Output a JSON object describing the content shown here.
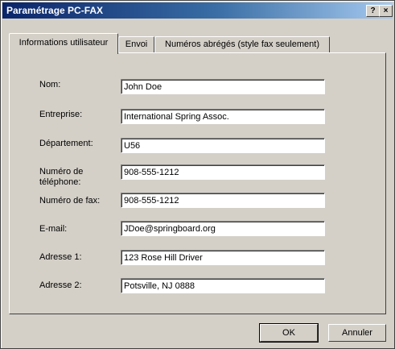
{
  "window": {
    "title": "Paramétrage PC-FAX",
    "help_glyph": "?",
    "close_glyph": "×"
  },
  "tabs": [
    {
      "label": "Informations utilisateur",
      "active": true
    },
    {
      "label": "Envoi",
      "active": false
    },
    {
      "label": "Numéros abrégés (style fax seulement)",
      "active": false
    }
  ],
  "fields": {
    "nom": {
      "label": "Nom:",
      "value": "John Doe"
    },
    "entreprise": {
      "label": "Entreprise:",
      "value": "International Spring Assoc."
    },
    "departement": {
      "label": "Département:",
      "value": "U56"
    },
    "telephone": {
      "label": "Numéro de\ntéléphone:",
      "value": "908-555-1212"
    },
    "fax": {
      "label": "Numéro de fax:",
      "value": "908-555-1212"
    },
    "email": {
      "label": "E-mail:",
      "value": "JDoe@springboard.org"
    },
    "adresse1": {
      "label": "Adresse 1:",
      "value": "123 Rose Hill Driver"
    },
    "adresse2": {
      "label": "Adresse 2:",
      "value": "Potsville, NJ 0888"
    }
  },
  "buttons": {
    "ok": "OK",
    "cancel": "Annuler"
  }
}
